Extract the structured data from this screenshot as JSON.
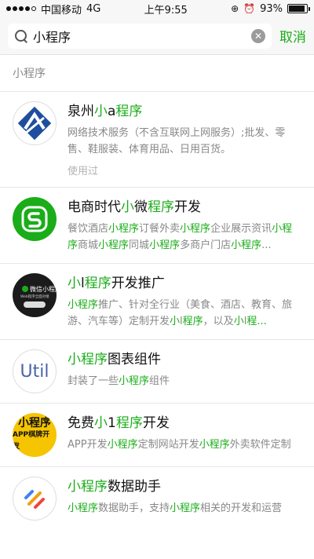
{
  "status": {
    "carrier": "中国移动",
    "network": "4G",
    "time": "上午9:55",
    "battery": "93%",
    "battery_level": 0.93
  },
  "search": {
    "query": "小程序",
    "cancel_label": "取消"
  },
  "section_title": "小程序",
  "results": [
    {
      "title": [
        {
          "t": "泉州"
        },
        {
          "t": "小",
          "hl": true
        },
        {
          "t": "a"
        },
        {
          "t": "程序",
          "hl": true
        }
      ],
      "desc": [
        {
          "t": "网络技术服务（不含互联网上网服务）;批发、零售、鞋服装、体育用品、日用百货。"
        }
      ],
      "used": "使用过",
      "icon": "quanzhou-logo-icon"
    },
    {
      "title": [
        {
          "t": "电商时代"
        },
        {
          "t": "小",
          "hl": true
        },
        {
          "t": "微"
        },
        {
          "t": "程序",
          "hl": true
        },
        {
          "t": "开发"
        }
      ],
      "desc": [
        {
          "t": "餐饮酒店"
        },
        {
          "t": "小程序",
          "hl": true
        },
        {
          "t": "订餐外卖"
        },
        {
          "t": "小程序",
          "hl": true
        },
        {
          "t": "企业展示资讯"
        },
        {
          "t": "小程序",
          "hl": true
        },
        {
          "t": "商城"
        },
        {
          "t": "小程序",
          "hl": true
        },
        {
          "t": "同城"
        },
        {
          "t": "小程序",
          "hl": true
        },
        {
          "t": "多商户门店"
        },
        {
          "t": "小程序",
          "hl": true
        },
        {
          "t": "..."
        }
      ],
      "icon": "dianshang-logo-icon"
    },
    {
      "title": [
        {
          "t": "小",
          "hl": true
        },
        {
          "t": "l"
        },
        {
          "t": "程序",
          "hl": true
        },
        {
          "t": "开发推广"
        }
      ],
      "desc": [
        {
          "t": "小程序",
          "hl": true
        },
        {
          "t": "推广、针对全行业（美食、酒店、教育、旅游、汽车等）定制开发"
        },
        {
          "t": "小",
          "hl": true
        },
        {
          "t": "l"
        },
        {
          "t": "程序",
          "hl": true
        },
        {
          "t": "，以及"
        },
        {
          "t": "小",
          "hl": true
        },
        {
          "t": "l"
        },
        {
          "t": "程...",
          "hl": true
        }
      ],
      "icon": "weixin-xiaochengxu-logo-icon",
      "icon_text": [
        "微信小程序",
        "Web程序全面对接"
      ]
    },
    {
      "title": [
        {
          "t": "小程序",
          "hl": true
        },
        {
          "t": "图表组件"
        }
      ],
      "desc": [
        {
          "t": "封装了一些"
        },
        {
          "t": "小程序",
          "hl": true
        },
        {
          "t": "组件"
        }
      ],
      "icon": "util-logo-icon",
      "icon_text": "Util"
    },
    {
      "title": [
        {
          "t": "免费"
        },
        {
          "t": "小",
          "hl": true
        },
        {
          "t": "1"
        },
        {
          "t": "程序",
          "hl": true
        },
        {
          "t": "开发"
        }
      ],
      "desc": [
        {
          "t": "APP开发"
        },
        {
          "t": "小程序",
          "hl": true
        },
        {
          "t": "定制网站开发"
        },
        {
          "t": "小程序",
          "hl": true
        },
        {
          "t": "外卖软件定制"
        }
      ],
      "icon": "free-dev-logo-icon",
      "icon_text": [
        "小程序",
        "APP棋牌开发"
      ]
    },
    {
      "title": [
        {
          "t": "小程序",
          "hl": true
        },
        {
          "t": "数据助手"
        }
      ],
      "desc": [
        {
          "t": "小程序",
          "hl": true
        },
        {
          "t": "数据助手，支持"
        },
        {
          "t": "小程序",
          "hl": true
        },
        {
          "t": "相关的开发和运营"
        }
      ],
      "icon": "data-helper-logo-icon"
    }
  ],
  "colors": {
    "accent": "#1aad19",
    "secondary_text": "#888888"
  }
}
